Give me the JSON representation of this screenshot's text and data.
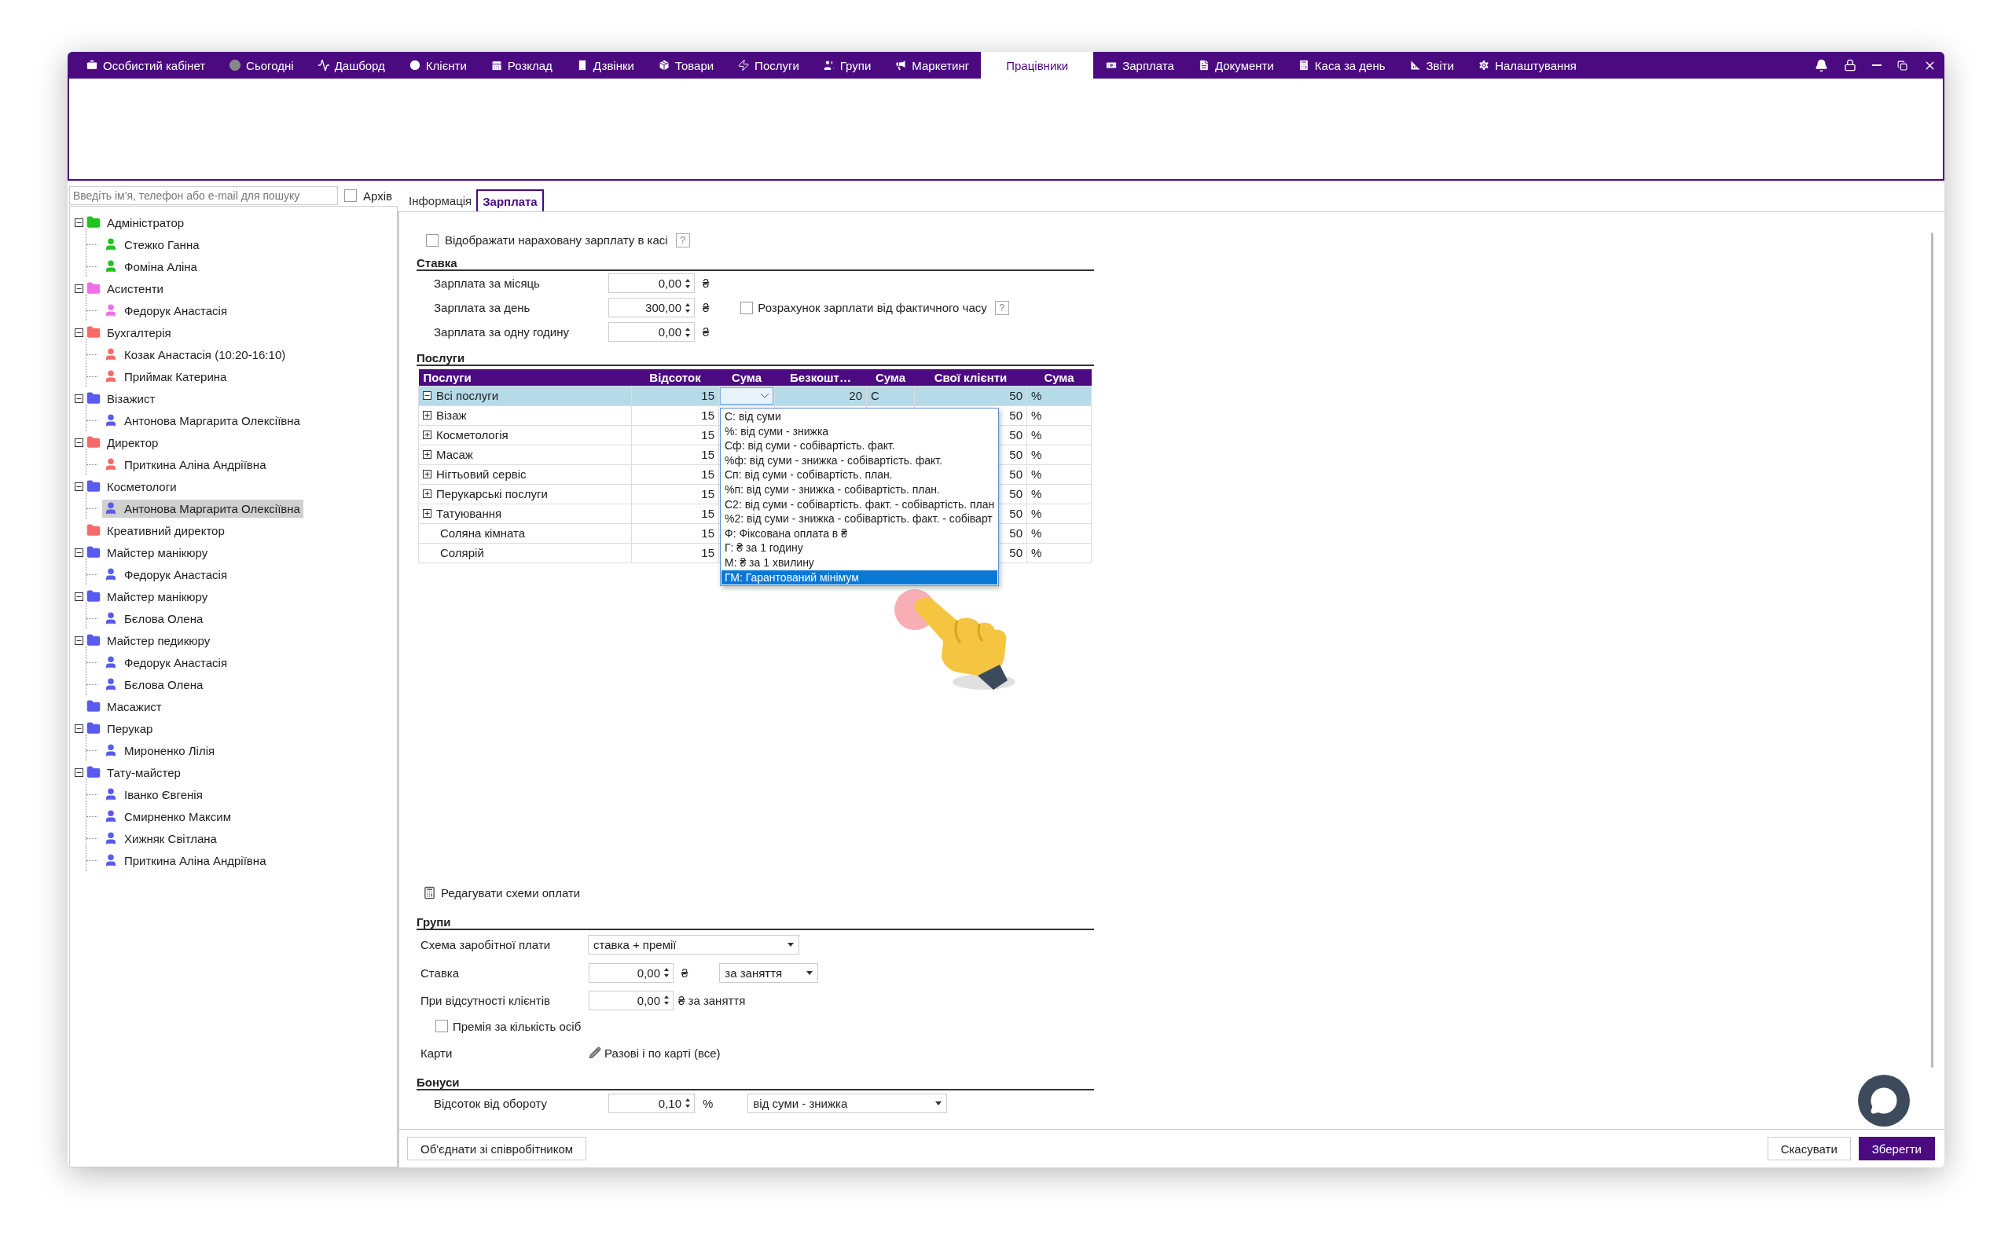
{
  "nav": {
    "items": [
      {
        "label": "Особистий кабінет",
        "selected": false
      },
      {
        "label": "Сьогодні",
        "selected": false
      },
      {
        "label": "Дашборд",
        "selected": false
      },
      {
        "label": "Клієнти",
        "selected": false
      },
      {
        "label": "Розклад",
        "selected": false
      },
      {
        "label": "Дзвінки",
        "selected": false
      },
      {
        "label": "Товари",
        "selected": false
      },
      {
        "label": "Послуги",
        "selected": false
      },
      {
        "label": "Групи",
        "selected": false
      },
      {
        "label": "Маркетинг",
        "selected": false
      },
      {
        "label": "Працівники",
        "selected": true
      },
      {
        "label": "Зарплата",
        "selected": false
      },
      {
        "label": "Документи",
        "selected": false
      },
      {
        "label": "Каса за день",
        "selected": false
      },
      {
        "label": "Звіти",
        "selected": false
      },
      {
        "label": "Налаштування",
        "selected": false
      }
    ]
  },
  "search": {
    "placeholder": "Введіть ім'я, телефон або e-mail для пошуку"
  },
  "archive": {
    "label": "Архів",
    "checked": false
  },
  "tree": [
    {
      "label": "Адміністратор",
      "color": "#1fc41f",
      "expanded": true,
      "selected": false,
      "children": [
        {
          "label": "Стежко Ганна",
          "selected": false
        },
        {
          "label": "Фоміна Аліна",
          "selected": false
        }
      ]
    },
    {
      "label": "Асистенти",
      "color": "#ee6ee8",
      "expanded": true,
      "selected": false,
      "children": [
        {
          "label": "Федорук Анастасія",
          "selected": false
        }
      ]
    },
    {
      "label": "Бухгалтерія",
      "color": "#f76a6a",
      "expanded": true,
      "selected": false,
      "children": [
        {
          "label": "Козак Анастасія (10:20-16:10)",
          "selected": false
        },
        {
          "label": "Приймак Катерина",
          "selected": false
        }
      ]
    },
    {
      "label": "Візажист",
      "color": "#5a5af0",
      "expanded": true,
      "selected": false,
      "children": [
        {
          "label": "Антонова Маргарита Олексіївна",
          "selected": false
        }
      ]
    },
    {
      "label": "Директор",
      "color": "#f76a6a",
      "expanded": true,
      "selected": false,
      "children": [
        {
          "label": "Приткина Аліна Андріївна",
          "selected": false
        }
      ]
    },
    {
      "label": "Косметологи",
      "color": "#5a5af0",
      "expanded": true,
      "selected": false,
      "children": [
        {
          "label": "Антонова Маргарита Олексіївна",
          "selected": true
        }
      ]
    },
    {
      "label": "Креативний директор",
      "color": "#f76a6a",
      "selected": false
    },
    {
      "label": "Майстер манікюру",
      "color": "#5a5af0",
      "expanded": true,
      "selected": false,
      "children": [
        {
          "label": "Федорук Анастасія",
          "selected": false
        }
      ]
    },
    {
      "label": "Майстер манікюру",
      "color": "#5a5af0",
      "expanded": true,
      "selected": false,
      "children": [
        {
          "label": "Бєлова Олена",
          "selected": false
        }
      ]
    },
    {
      "label": "Майстер педикюру",
      "color": "#5a5af0",
      "expanded": true,
      "selected": false,
      "children": [
        {
          "label": "Федорук Анастасія",
          "selected": false
        },
        {
          "label": "Бєлова Олена",
          "selected": false
        }
      ]
    },
    {
      "label": "Масажист",
      "color": "#5a5af0",
      "selected": false
    },
    {
      "label": "Перукар",
      "color": "#5a5af0",
      "expanded": true,
      "selected": false,
      "children": [
        {
          "label": "Мироненко Лілія",
          "selected": false
        }
      ]
    },
    {
      "label": "Тату-майстер",
      "color": "#5a5af0",
      "expanded": true,
      "selected": false,
      "children": [
        {
          "label": "Іванко Євгенія",
          "selected": false
        },
        {
          "label": "Смирненко Максим",
          "selected": false
        },
        {
          "label": "Хижняк Світлана",
          "selected": false
        },
        {
          "label": "Приткина Аліна Андріївна",
          "selected": false
        }
      ]
    }
  ],
  "tabs": [
    {
      "label": "Інформація",
      "selected": false
    },
    {
      "label": "Зарплата",
      "selected": true
    }
  ],
  "show_in_cash": {
    "label": "Відображати нараховану зарплату в касі",
    "checked": false,
    "help": "?"
  },
  "rate": {
    "heading": "Ставка",
    "rows": [
      {
        "label": "Зарплата за місяць",
        "value": "0,00",
        "unit": "₴"
      },
      {
        "label": "Зарплата за день",
        "value": "300,00",
        "unit": "₴"
      },
      {
        "label": "Зарплата за одну годину",
        "value": "0,00",
        "unit": "₴"
      }
    ],
    "actual_time": {
      "label": "Розрахунок зарплати від фактичного часу",
      "checked": false,
      "help": "?"
    }
  },
  "services": {
    "heading": "Послуги",
    "columns": [
      "Послуги",
      "Відсоток",
      "Сума",
      "Безкошт…",
      "Сума",
      "Свої клієнти",
      "Сума"
    ],
    "rows": [
      {
        "name": "Всі послуги",
        "expanded": true,
        "selected": true,
        "percent": "15",
        "free": "20",
        "free_unit": "C",
        "own": "50",
        "own_unit": "%"
      },
      {
        "name": "Візаж",
        "expanded": false,
        "selected": false,
        "percent": "15",
        "own": "50",
        "own_unit": "%"
      },
      {
        "name": "Косметологія",
        "expanded": false,
        "selected": false,
        "percent": "15",
        "own": "50",
        "own_unit": "%"
      },
      {
        "name": "Масаж",
        "expanded": false,
        "selected": false,
        "percent": "15",
        "own": "50",
        "own_unit": "%"
      },
      {
        "name": "Нігтьовий сервіс",
        "expanded": false,
        "selected": false,
        "percent": "15",
        "own": "50",
        "own_unit": "%"
      },
      {
        "name": "Перукарські послуги",
        "expanded": false,
        "selected": false,
        "percent": "15",
        "own": "50",
        "own_unit": "%"
      },
      {
        "name": "Татуювання",
        "expanded": false,
        "selected": false,
        "percent": "15",
        "own": "50",
        "own_unit": "%"
      },
      {
        "name": "Соляна кімната",
        "selected": false,
        "percent": "15",
        "own": "50",
        "own_unit": "%"
      },
      {
        "name": "Солярій",
        "selected": false,
        "percent": "15",
        "own": "50",
        "own_unit": "%"
      }
    ],
    "dropdown": {
      "open": true,
      "options": [
        {
          "label": "С: від суми",
          "selected": false
        },
        {
          "label": "%: від суми - знижка",
          "selected": false
        },
        {
          "label": "Сф: від суми - собівартість. факт.",
          "selected": false
        },
        {
          "label": "%ф: від суми - знижка - собівартість. факт.",
          "selected": false
        },
        {
          "label": "Сп: від суми - собівартість. план.",
          "selected": false
        },
        {
          "label": "%п: від суми - знижка - собівартість. план.",
          "selected": false
        },
        {
          "label": "С2: від суми - собівартість. факт. - собівартість. план",
          "selected": false
        },
        {
          "label": "%2: від суми - знижка - собівартість. факт. - собіварт",
          "selected": false
        },
        {
          "label": "Ф: Фіксована оплата в ₴",
          "selected": false
        },
        {
          "label": "Г: ₴ за 1 годину",
          "selected": false
        },
        {
          "label": "М: ₴ за 1 хвилину",
          "selected": false
        },
        {
          "label": "ГМ: Гарантований мінімум",
          "selected": true
        }
      ]
    }
  },
  "edit_schemes": {
    "label": "Редагувати схеми оплати"
  },
  "groups": {
    "heading": "Групи",
    "scheme": {
      "label": "Схема заробітної плати",
      "value": "ставка + премії"
    },
    "rate": {
      "label": "Ставка",
      "value": "0,00",
      "unit": "₴",
      "period": "за заняття"
    },
    "no_clients": {
      "label": "При відсутності клієнтів",
      "value": "0,00",
      "unit": "₴ за заняття"
    },
    "bonus_per_person": {
      "label": "Премія за кількість осіб",
      "checked": false
    },
    "cards": {
      "label": "Карти",
      "value": "Разові і по карті (все)"
    }
  },
  "bonuses": {
    "heading": "Бонуси",
    "turnover": {
      "label": "Відсоток від обороту",
      "value": "0,10",
      "unit": "%",
      "basis": "від суми - знижка"
    }
  },
  "footer": {
    "merge": "Об'єднати зі співробітником",
    "cancel": "Скасувати",
    "save": "Зберегти"
  }
}
